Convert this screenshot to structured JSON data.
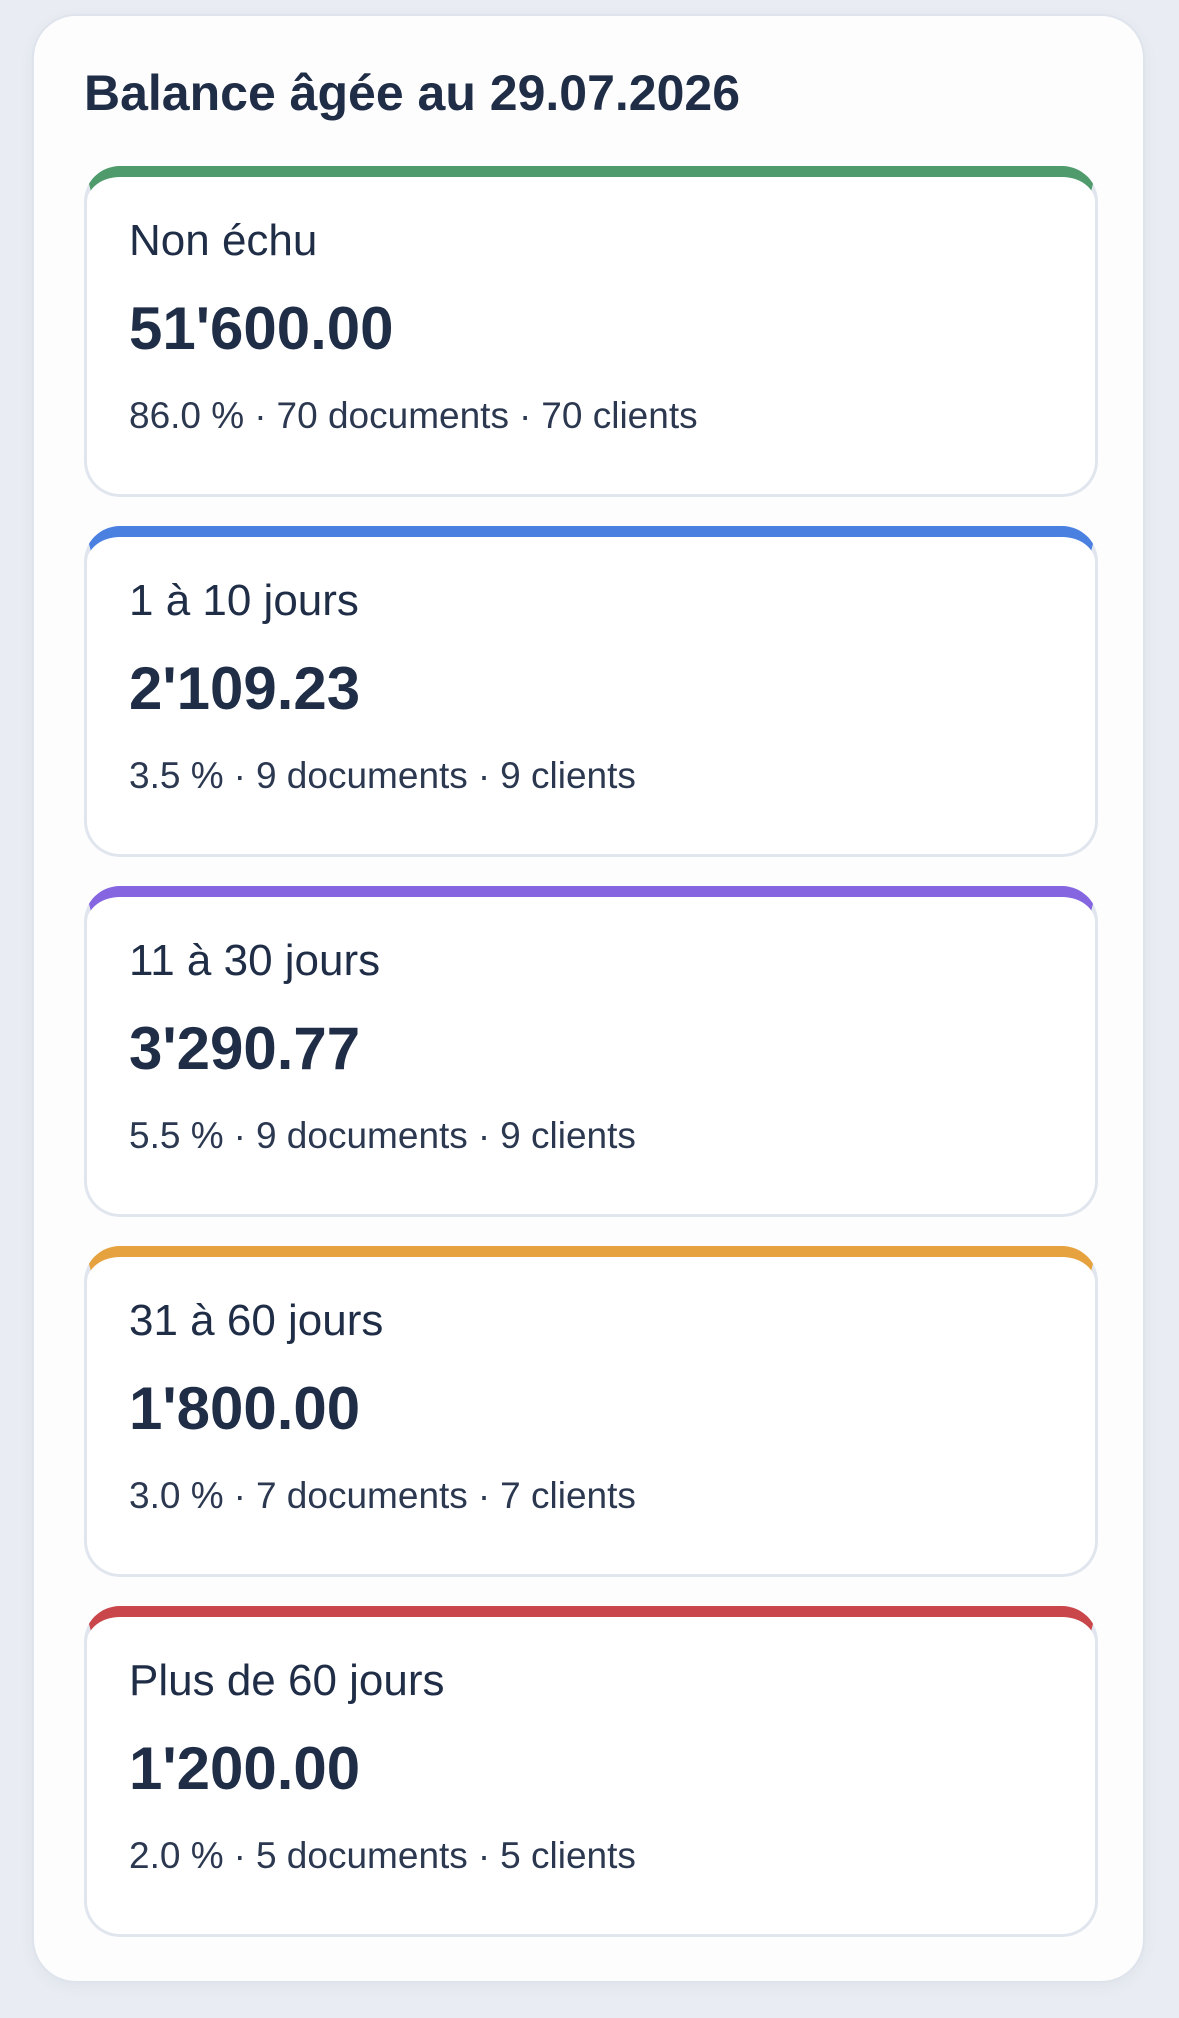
{
  "title": "Balance âgée au 29.07.2026",
  "separator": "·",
  "buckets": [
    {
      "label": "Non échu",
      "amount": "51'600.00",
      "percent": "86.0 %",
      "documents": "70 documents",
      "clients": "70 clients",
      "accent_color": "#4f9b6c"
    },
    {
      "label": "1 à 10 jours",
      "amount": "2'109.23",
      "percent": "3.5 %",
      "documents": "9 documents",
      "clients": "9 clients",
      "accent_color": "#4a80e0"
    },
    {
      "label": "11 à 30 jours",
      "amount": "3'290.77",
      "percent": "5.5 %",
      "documents": "9 documents",
      "clients": "9 clients",
      "accent_color": "#8565e0"
    },
    {
      "label": "31 à 60 jours",
      "amount": "1'800.00",
      "percent": "3.0 %",
      "documents": "7 documents",
      "clients": "7 clients",
      "accent_color": "#e6a23e"
    },
    {
      "label": "Plus de 60 jours",
      "amount": "1'200.00",
      "percent": "2.0 %",
      "documents": "5 documents",
      "clients": "5 clients",
      "accent_color": "#c9474b"
    }
  ]
}
